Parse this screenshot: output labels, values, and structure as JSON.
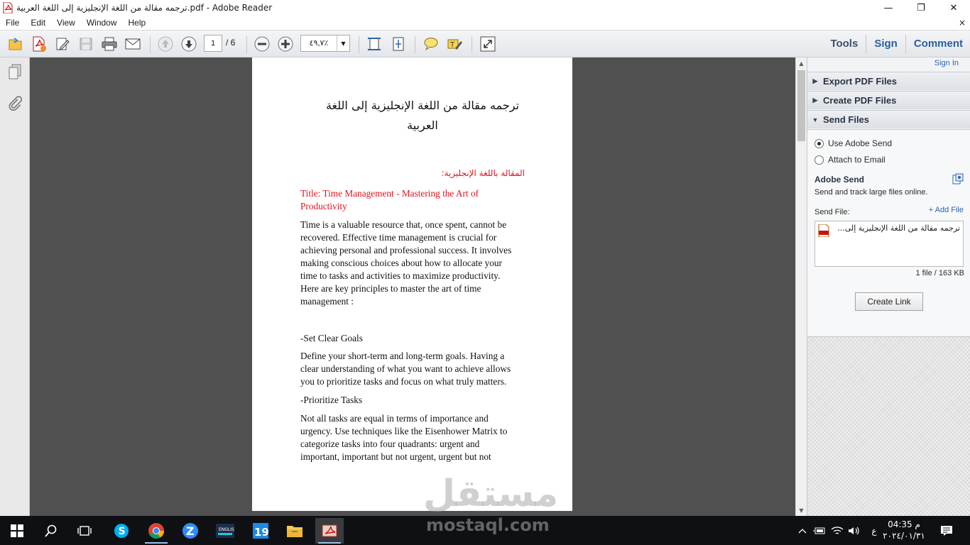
{
  "window": {
    "title": "ترجمه مقالة من اللغة الإنجليزية إلى اللغة العربية.pdf - Adobe Reader",
    "minimize": "—",
    "maximize": "❐",
    "close": "✕"
  },
  "menu": {
    "items": [
      "File",
      "Edit",
      "View",
      "Window",
      "Help"
    ],
    "doc_close": "×"
  },
  "toolbar": {
    "page_current": "1",
    "page_total": "/ 6",
    "zoom": "٤٩,٧٪",
    "tools": "Tools",
    "sign": "Sign",
    "comment": "Comment"
  },
  "document": {
    "title_line1": "ترجمه مقالة من اللغة الإنجليزية إلى اللغة",
    "title_line2": "العربية",
    "heading_ar": "المقالة باللغة الإنجليزية:",
    "article_title_1": "Title: Time Management - Mastering the Art of",
    "article_title_2": "Productivity",
    "para1": [
      "Time is a valuable resource that, once spent, cannot be",
      "recovered. Effective time management is crucial for",
      "achieving personal and professional success. It involves",
      "making conscious choices about how to allocate your",
      "time to tasks and activities to maximize productivity.",
      "Here are key principles to master the art of time",
      "management :"
    ],
    "sub1": "-Set Clear Goals",
    "para2": [
      "Define your short-term and long-term goals. Having a",
      "clear understanding of what you want to achieve allows",
      "you to prioritize tasks and focus on what truly matters."
    ],
    "sub2": "-Prioritize Tasks",
    "para3": [
      "Not all tasks are equal in terms of importance and",
      "urgency. Use techniques like the Eisenhower Matrix to",
      "categorize tasks into four quadrants: urgent and",
      "important, important but not urgent, urgent but not"
    ]
  },
  "right_pane": {
    "sign_in": "Sign In",
    "panels": [
      "Export PDF Files",
      "Create PDF Files",
      "Send Files"
    ],
    "send": {
      "option1": "Use Adobe Send",
      "option2": "Attach to Email",
      "selected": "Use Adobe Send",
      "title": "Adobe Send",
      "desc": "Send and track large files online.",
      "send_file_label": "Send File:",
      "add_file": "+ Add File",
      "file_name": "ترجمه مقالة من اللغة الإنجليزية إلى...",
      "file_count": "1 file / 163 KB",
      "create_link": "Create Link"
    }
  },
  "taskbar": {
    "clock_time": "04:35 م",
    "clock_date": "٢٠٢٤/٠١/٣١",
    "lang": "ع"
  },
  "watermark": {
    "ar": "مستقل",
    "en": "mostaql.com"
  },
  "colors": {
    "accent_link": "#2a63b4",
    "doc_red": "#e0141e",
    "doc_bg": "#505050"
  }
}
